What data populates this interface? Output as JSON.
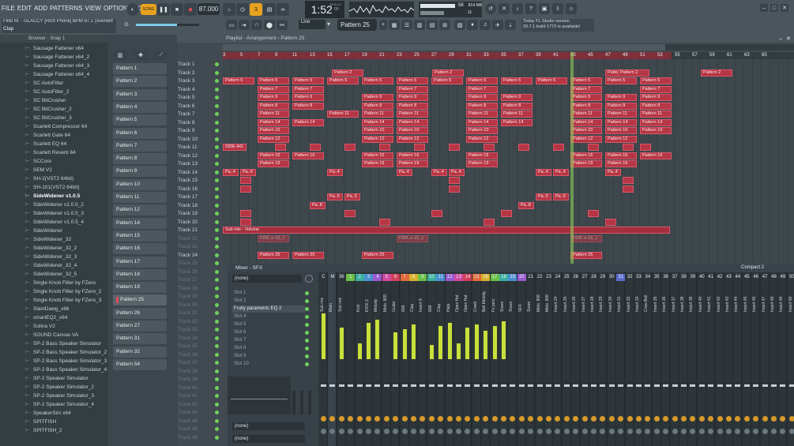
{
  "menu": [
    "FILE",
    "EDIT",
    "ADD",
    "PATTERNS",
    "VIEW",
    "OPTIONS",
    "TOOLS",
    "HELP"
  ],
  "hint_line": "Flillo M. - GLACCY [Rich Phonk] BPM 87.1 (overwrit",
  "hint_channel": "Clap",
  "transport": {
    "song_mode": "SONG",
    "tempo": "87.000",
    "time": "1:52",
    "time_sub": "00",
    "time_label": "M:S:CS"
  },
  "cpu": {
    "value": "58",
    "mem": "814 MB",
    "poly": "11"
  },
  "news": {
    "line1": "Today  FL Studio version",
    "line2": "20.7.1 build 1773 is available!"
  },
  "pattern_selector": "Pattern 25",
  "snap": "Line",
  "browser": {
    "header": "Browser - Snap 1",
    "items": [
      "Sausage Fattener x64",
      "Sausage Fattener x64_2",
      "Sausage Fattener x64_3",
      "Sausage Fattener x64_4",
      "SC AutoFilter",
      "SC AutoFilter_2",
      "SC BitCrusher",
      "SC BitCrusher_2",
      "SC BitCrusher_3",
      "Scarlett Compressor 64",
      "Scarlett Gate 64",
      "Scarlett EQ 64",
      "Scarlett Reverb 64",
      "SCCore",
      "SEM V2",
      "SH-2(VST2 64bit)",
      "SH-101(VST2 64bit)",
      "SideWidener v1.0.5",
      "SideWidener v1.0.5_2",
      "SideWidener v1.0.5_3",
      "SideWidener v1.0.5_4",
      "SideWidener",
      "SideWidener_32",
      "SideWidener_32_2",
      "SideWidener_32_3",
      "SideWidener_32_4",
      "SideWidener_32_5",
      "Single Knob Filter by FZero",
      "Single Knob Filter by FZero_2",
      "Single Knob Filter by FZero_3",
      "SlamDawg_x86",
      "smartEQ2_x64",
      "Solina V2",
      "SOUND Canvas VA",
      "SP-2 Bass Speaker Simulator",
      "SP-2 Bass Speaker Simulator_2",
      "SP-2 Bass Speaker Simulator_3",
      "SP-2 Bass Speaker Simulator_4",
      "SP-2 Speaker Simulator",
      "SP-2 Speaker Simulator_2",
      "SP-2 Speaker Simulator_3",
      "SP-2 Speaker Simulator_4",
      "SpeakerSim x64",
      "SPITFISH",
      "SPITFISH_2"
    ],
    "selected_index": 17
  },
  "patterns": [
    "Pattern 1",
    "Pattern 2",
    "Pattern 3",
    "Pattern 4",
    "Pattern 5",
    "Pattern 6",
    "Pattern 7",
    "Pattern 8",
    "Pattern 9",
    "Pattern 10",
    "Pattern 11",
    "Pattern 12",
    "Pattern 14",
    "Pattern 15",
    "Pattern 16",
    "Pattern 17",
    "Pattern 18",
    "Pattern 19",
    "Pattern 25",
    "Pattern 26",
    "Pattern 27",
    "Pattern 31",
    "Pattern 32",
    "Pattern 54"
  ],
  "active_pattern_index": 18,
  "playlist": {
    "title": "Playlist - Arrangement › Pattern 25",
    "ruler": [
      "3",
      "5",
      "7",
      "9",
      "11",
      "13",
      "15",
      "17",
      "19",
      "21",
      "23",
      "25",
      "27",
      "29",
      "31",
      "33",
      "35",
      "37",
      "39",
      "41",
      "43",
      "45",
      "47",
      "49",
      "51",
      "53",
      "55",
      "57",
      "59",
      "61",
      "63",
      "65"
    ],
    "tracks": [
      "Track 1",
      "Track 2",
      "Track 3",
      "Track 4",
      "Track 5",
      "Track 6",
      "Track 7",
      "Track 8",
      "Track 9",
      "Track 10",
      "Track 11",
      "Track 12",
      "Track 13",
      "Track 14",
      "Track 15",
      "Track 16",
      "Track 17",
      "Track 18",
      "Track 19",
      "Track 20",
      "Track 21",
      "Track 22",
      "Track 23",
      "Track 24",
      "Track 25",
      "Track 26",
      "Track 27",
      "Track 28",
      "Track 29",
      "Track 30",
      "Track 31",
      "Track 32",
      "Track 33",
      "Track 34",
      "Track 35",
      "Track 36",
      "Track 37",
      "Track 38",
      "Track 39",
      "Track 40",
      "Track 41",
      "Track 42",
      "Track 43",
      "Track 44",
      "Track 45",
      "Track 46"
    ],
    "clip_labels": {
      "track2": "Pattern 2",
      "track3": "Pattern 5",
      "track4": "Pattern 7",
      "track5": "Pattern 9",
      "track6": "Pattern 8",
      "track7": "Pattern 11",
      "track8": "Pattern 14",
      "track9": "Pattern 10",
      "track10": "Pattern 12",
      "track11": "SIDE-AG",
      "track12": "Pattern 16",
      "track13": "Pattern 19",
      "track14": "Pa..4",
      "track17": "Pa..5",
      "track18": "Pa..8",
      "track21": "Sub mix - Volume",
      "track22": "FDR..n-15_1",
      "track24": "Pattern 25",
      "track24b": "Pat..5",
      "track9b": "SO..5"
    }
  },
  "mixer": {
    "title": "Mixer - SFX",
    "compact": "Compact 2",
    "top_slot": "(none)",
    "slots": [
      "Slot 1",
      "Slot 2",
      "Fruity parametric EQ 2",
      "Slot 4",
      "Slot 5",
      "Slot 6",
      "Slot 7",
      "Slot 8",
      "Slot 9",
      "Slot 10"
    ],
    "bottom_slots": [
      "(none)",
      "(none)"
    ],
    "strips": [
      {
        "num": "C",
        "name": "Sub mix"
      },
      {
        "num": "M",
        "name": "Main"
      },
      {
        "num": "36",
        "name": "Sub mix"
      },
      {
        "num": "1",
        "name": ""
      },
      {
        "num": "2",
        "name": "Kick"
      },
      {
        "num": "3",
        "name": "KICK 2"
      },
      {
        "num": "4",
        "name": "Melody"
      },
      {
        "num": "5",
        "name": "Melo. 808"
      },
      {
        "num": "6",
        "name": "Guitar"
      },
      {
        "num": "7",
        "name": "808"
      },
      {
        "num": "8",
        "name": "Clap"
      },
      {
        "num": "9",
        "name": "Insert 9"
      },
      {
        "num": "10",
        "name": "808"
      },
      {
        "num": "11",
        "name": "Clap"
      },
      {
        "num": "12",
        "name": "Hats"
      },
      {
        "num": "13",
        "name": "Open Hat"
      },
      {
        "num": "14",
        "name": "Open Hat"
      },
      {
        "num": "15",
        "name": "Crash"
      },
      {
        "num": "16",
        "name": "Bell Melody"
      },
      {
        "num": "17",
        "name": "Fx perc"
      },
      {
        "num": "18",
        "name": "Snare"
      },
      {
        "num": "19",
        "name": "Snare"
      },
      {
        "num": "20",
        "name": "SFX"
      },
      {
        "num": "21",
        "name": "Snare"
      },
      {
        "num": "22",
        "name": "Melo. 808"
      },
      {
        "num": "23",
        "name": "Melo. 808"
      },
      {
        "num": "24",
        "name": "Insert 24"
      },
      {
        "num": "25",
        "name": "Insert 25"
      },
      {
        "num": "26",
        "name": "Insert 26"
      },
      {
        "num": "27",
        "name": "Insert 27"
      },
      {
        "num": "28",
        "name": "Insert 28"
      },
      {
        "num": "29",
        "name": "Insert 29"
      },
      {
        "num": "30",
        "name": "Insert 30"
      },
      {
        "num": "31",
        "name": "Insert 31"
      },
      {
        "num": "32",
        "name": "Insert 32"
      },
      {
        "num": "33",
        "name": "Insert 33"
      },
      {
        "num": "34",
        "name": "Crow Bell"
      },
      {
        "num": "35",
        "name": "Insert 35"
      },
      {
        "num": "36",
        "name": "Insert 36"
      },
      {
        "num": "37",
        "name": "Insert 37"
      },
      {
        "num": "38",
        "name": "Insert 38"
      },
      {
        "num": "39",
        "name": "Insert 39"
      },
      {
        "num": "40",
        "name": "Insert 40"
      },
      {
        "num": "41",
        "name": "Insert 41"
      },
      {
        "num": "42",
        "name": "Insert 42"
      },
      {
        "num": "43",
        "name": "Insert 43"
      },
      {
        "num": "44",
        "name": "Insert 44"
      },
      {
        "num": "45",
        "name": "Insert 45"
      },
      {
        "num": "46",
        "name": "Insert 46"
      },
      {
        "num": "47",
        "name": "Insert 47"
      },
      {
        "num": "48",
        "name": "Insert 48"
      },
      {
        "num": "49",
        "name": "Insert 49"
      },
      {
        "num": "50",
        "name": "Insert 50"
      }
    ]
  },
  "colors": {
    "accent": "#e8a21f",
    "clip": "#b53644",
    "meter": "#c9e03a",
    "led": "#6fd05a"
  }
}
